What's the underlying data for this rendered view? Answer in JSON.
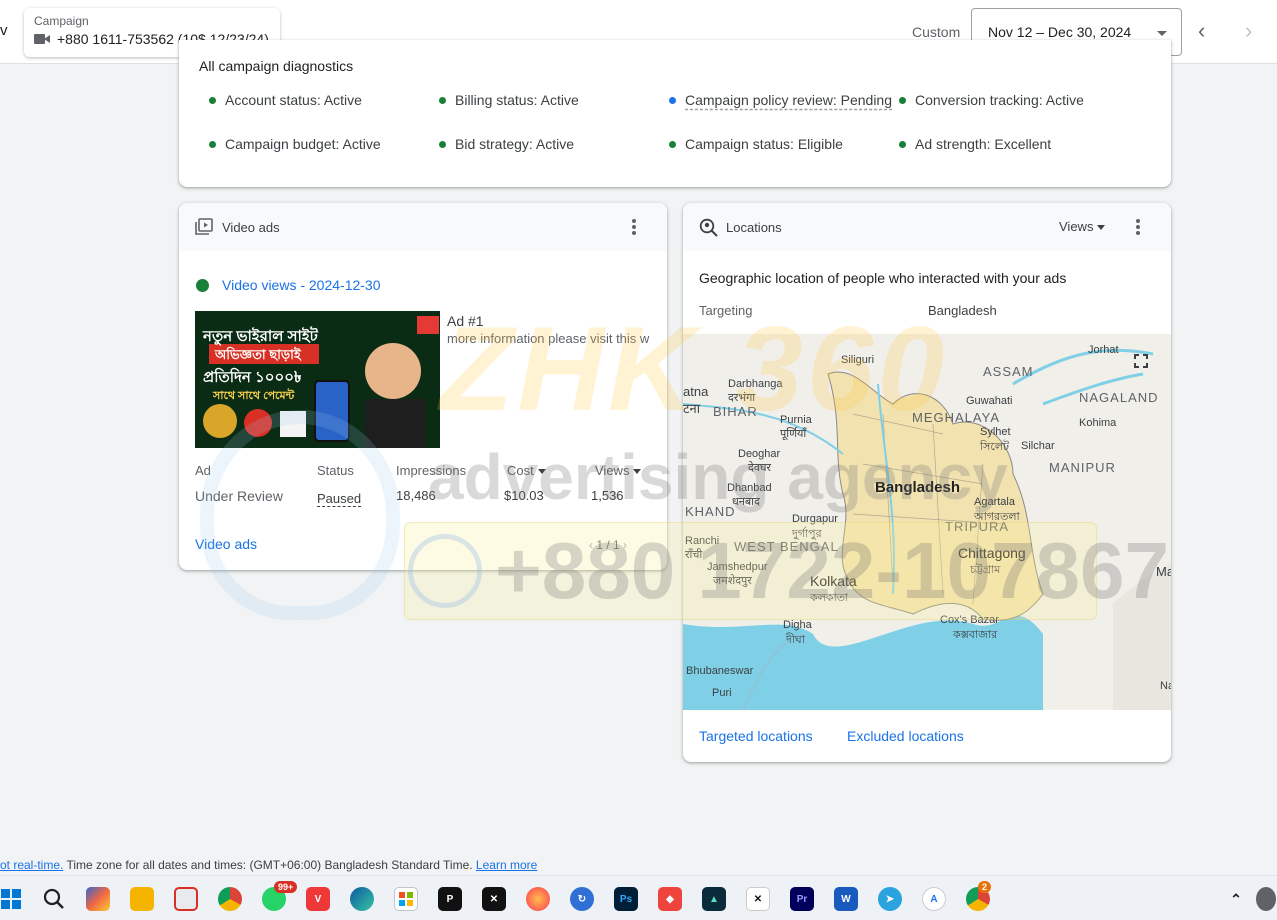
{
  "header": {
    "edge_char": "v",
    "campaign_label": "Campaign",
    "campaign_value": "+880 1611-753562 (10$ 12/23/24)",
    "custom_label": "Custom",
    "date_range": "Nov 12 – Dec 30, 2024"
  },
  "diagnostics": {
    "title": "All campaign diagnostics",
    "items": [
      {
        "label": "Account status: Active",
        "color": "#188038"
      },
      {
        "label": "Billing status: Active",
        "color": "#188038"
      },
      {
        "label": "Campaign policy review: Pending",
        "color": "#1a73e8"
      },
      {
        "label": "Conversion tracking: Active",
        "color": "#188038"
      },
      {
        "label": "Campaign budget: Active",
        "color": "#188038"
      },
      {
        "label": "Bid strategy: Active",
        "color": "#188038"
      },
      {
        "label": "Campaign status: Eligible",
        "color": "#188038"
      },
      {
        "label": "Ad strength: Excellent",
        "color": "#188038"
      }
    ]
  },
  "video_ads": {
    "title": "Video ads",
    "views_link": "Video views - 2024-12-30",
    "ad_name": "Ad #1",
    "ad_description": "more information please visit this w",
    "thumbnail": {
      "line1": "নতুন ভাইরাল সাইট",
      "line2": "অভিজ্ঞতা ছাড়াই",
      "line3": "প্রতিদিন ১০০০৳",
      "line4": "সাথে সাথে পেমেন্ট"
    },
    "columns": [
      "Ad",
      "Status",
      "Impressions",
      "Cost",
      "Views"
    ],
    "row": {
      "ad": "Under Review",
      "status": "Paused",
      "impressions": "18,486",
      "cost": "$10.03",
      "views": "1,536"
    },
    "pager": "1 / 1",
    "footer_link": "Video ads"
  },
  "locations": {
    "title": "Locations",
    "metric_dropdown": "Views",
    "subtitle": "Geographic location of people who interacted with your ads",
    "targeting_label": "Targeting",
    "targeting_value": "Bangladesh",
    "map_labels": {
      "siliguri": "Siliguri",
      "patna": "atna",
      "patna_bn": "टना",
      "darbhanga": "Darbhanga",
      "darbhanga_bn": "दरभंगा",
      "bihar": "BIHAR",
      "purnia": "Purnia",
      "purnia_bn": "पूर्णियाँ",
      "deoghar": "Deoghar",
      "deoghar_bn": "देवघर",
      "dhanbad": "Dhanbad",
      "dhanbad_bn": "धनबाद",
      "jharkhand": "KHAND",
      "durgapur": "Durgapur",
      "durgapur_bn": "দুর্গাপুর",
      "ranchi": "Ranchi",
      "ranchi_bn": "राँची",
      "west_bengal": "WEST BENGAL",
      "jamshedpur": "Jamshedpur",
      "jamshedpur_bn": "जमशेदपुर",
      "kolkata": "Kolkata",
      "kolkata_bn": "কলকাতা",
      "digha": "Digha",
      "digha_bn": "দীঘা",
      "bhubaneswar": "Bhubaneswar",
      "puri": "Puri",
      "assam": "ASSAM",
      "jorhat": "Jorhat",
      "guwahati": "Guwahati",
      "nagaland": "NAGALAND",
      "kohima": "Kohima",
      "meghalaya": "MEGHALAYA",
      "sylhet": "Sylhet",
      "sylhet_bn": "সিলেট",
      "silchar": "Silchar",
      "manipur": "MANIPUR",
      "bangladesh": "Bangladesh",
      "agartala": "Agartala",
      "agartala_bn": "আগরতলা",
      "tripura": "TRIPURA",
      "chittagong": "Chittagong",
      "chittagong_bn": "চট্টগ্রাম",
      "coxs_bazar": "Cox's Bazar",
      "coxs_bazar_bn": "কক্সবাজার",
      "edge_m": "Ma",
      "edge_na": "Na"
    },
    "links": {
      "targeted": "Targeted locations",
      "excluded": "Excluded locations"
    }
  },
  "watermark": {
    "brand": "ZHK 360",
    "tagline": "advertising agency",
    "phone": "+880 1722-107867"
  },
  "footer": {
    "prefix_link": "ot real-time.",
    "text": "Time zone for all dates and times: (GMT+06:00) Bangladesh Standard Time.",
    "learn_more": "Learn more"
  },
  "taskbar": {
    "whatsapp_badge": "99+",
    "chrome_badge": "2",
    "icons": [
      "windows-start",
      "search",
      "copilot",
      "file-explorer",
      "snipping-tool",
      "chrome",
      "whatsapp",
      "vivaldi",
      "edge",
      "microsoft-store",
      "capcut-pro",
      "capcut",
      "firefox",
      "sync",
      "photoshop",
      "anydesk",
      "filmora",
      "capcut-alt",
      "premiere-pro",
      "word",
      "telegram",
      "app",
      "chrome-profile"
    ]
  }
}
